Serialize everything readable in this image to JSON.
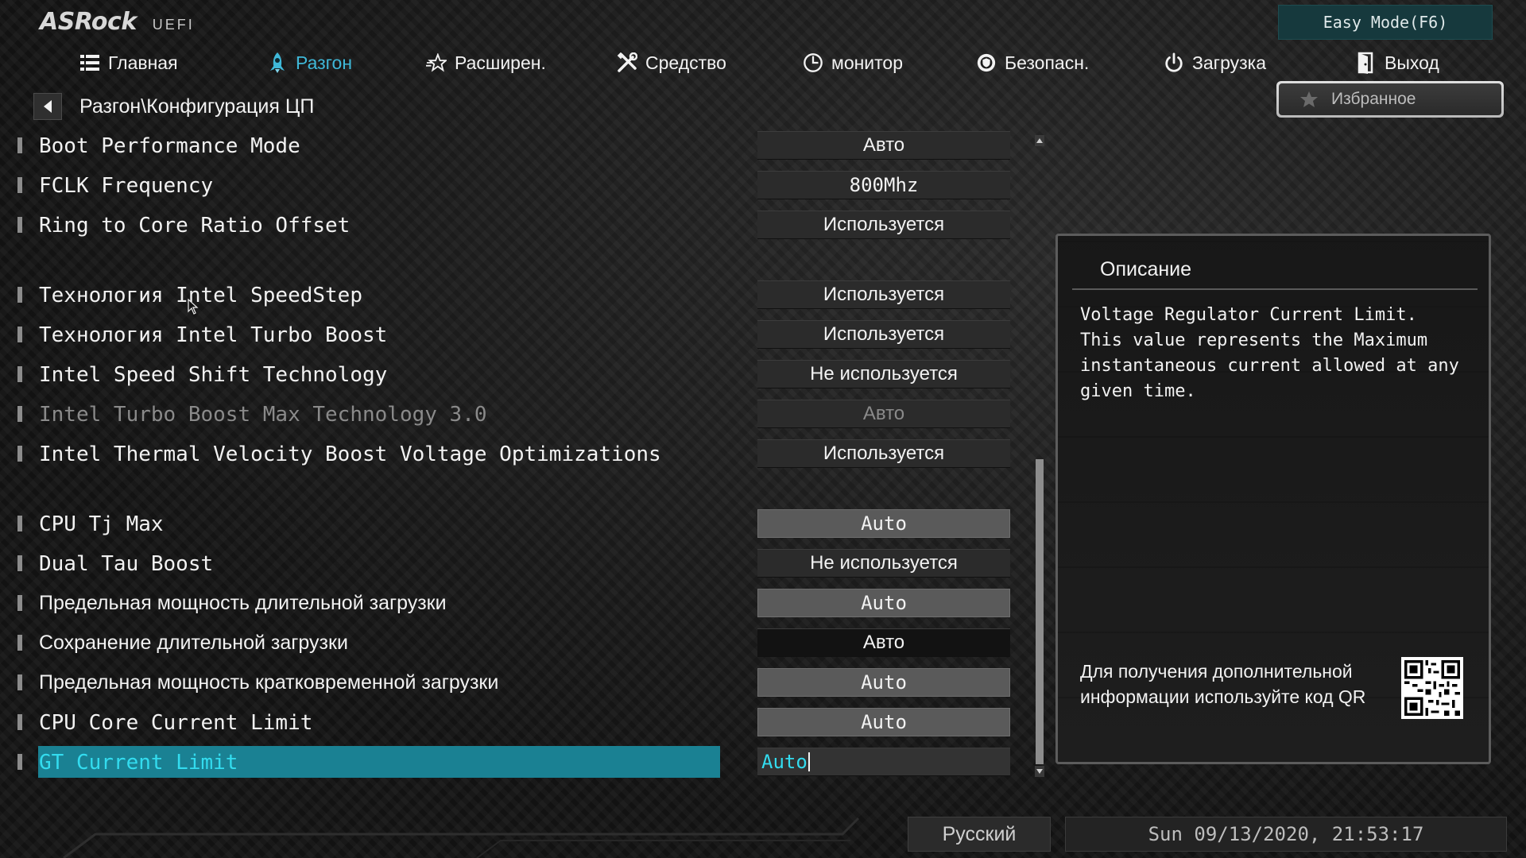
{
  "header": {
    "brand": "ASRock",
    "brand_sub": "UEFI",
    "easy_mode": "Easy Mode(F6)",
    "favorites": "Избранное"
  },
  "nav": {
    "tabs": [
      {
        "label": "Главная",
        "icon": "list-icon",
        "active": false
      },
      {
        "label": "Разгон",
        "icon": "rocket-icon",
        "active": true
      },
      {
        "label": "Расширен.",
        "icon": "star-icon",
        "active": false
      },
      {
        "label": "Средство",
        "icon": "tools-icon",
        "active": false
      },
      {
        "label": "монитор",
        "icon": "monitor-icon",
        "active": false
      },
      {
        "label": "Безопасн.",
        "icon": "shield-icon",
        "active": false
      },
      {
        "label": "Загрузка",
        "icon": "power-icon",
        "active": false
      },
      {
        "label": "Выход",
        "icon": "exit-icon",
        "active": false
      }
    ]
  },
  "breadcrumb": "Разгон\\Конфигурация ЦП",
  "settings": [
    {
      "label": "Boot Performance Mode",
      "value": "Авто"
    },
    {
      "label": "FCLK Frequency",
      "value": "800Mhz"
    },
    {
      "label": "Ring to Core Ratio Offset",
      "value": "Используется"
    },
    {
      "label": "Технология Intel SpeedStep",
      "value": "Используется"
    },
    {
      "label": "Технология Intel Turbo Boost",
      "value": "Используется"
    },
    {
      "label": "Intel Speed Shift Technology",
      "value": "Не используется"
    },
    {
      "label": "Intel Turbo Boost Max Technology 3.0",
      "value": "Авто",
      "disabled": true
    },
    {
      "label": "Intel Thermal Velocity Boost Voltage Optimizations",
      "value": "Используется"
    },
    {
      "label": "CPU Tj Max",
      "value": "Auto"
    },
    {
      "label": "Dual Tau Boost",
      "value": "Не используется"
    },
    {
      "label": "Предельная мощность длительной загрузки",
      "value": "Auto"
    },
    {
      "label": "Сохранение длительной загрузки",
      "value": "Авто"
    },
    {
      "label": "Предельная мощность кратковременной загрузки",
      "value": "Auto"
    },
    {
      "label": "CPU Core Current Limit",
      "value": "Auto"
    },
    {
      "label": "GT Current Limit",
      "value": "Auto",
      "selected": true
    }
  ],
  "description": {
    "title": "Описание",
    "text": "Voltage Regulator Current Limit.\nThis value represents the Maximum\ninstantaneous current allowed at any\ngiven time.",
    "qr_text": "Для получения дополнительной информации используйте код QR"
  },
  "footer": {
    "language": "Русский",
    "datetime": "Sun 09/13/2020, 21:53:17"
  },
  "colors": {
    "accent": "#3fb8d8",
    "selected_row": "#1a8193",
    "selected_text": "#33dcef"
  }
}
